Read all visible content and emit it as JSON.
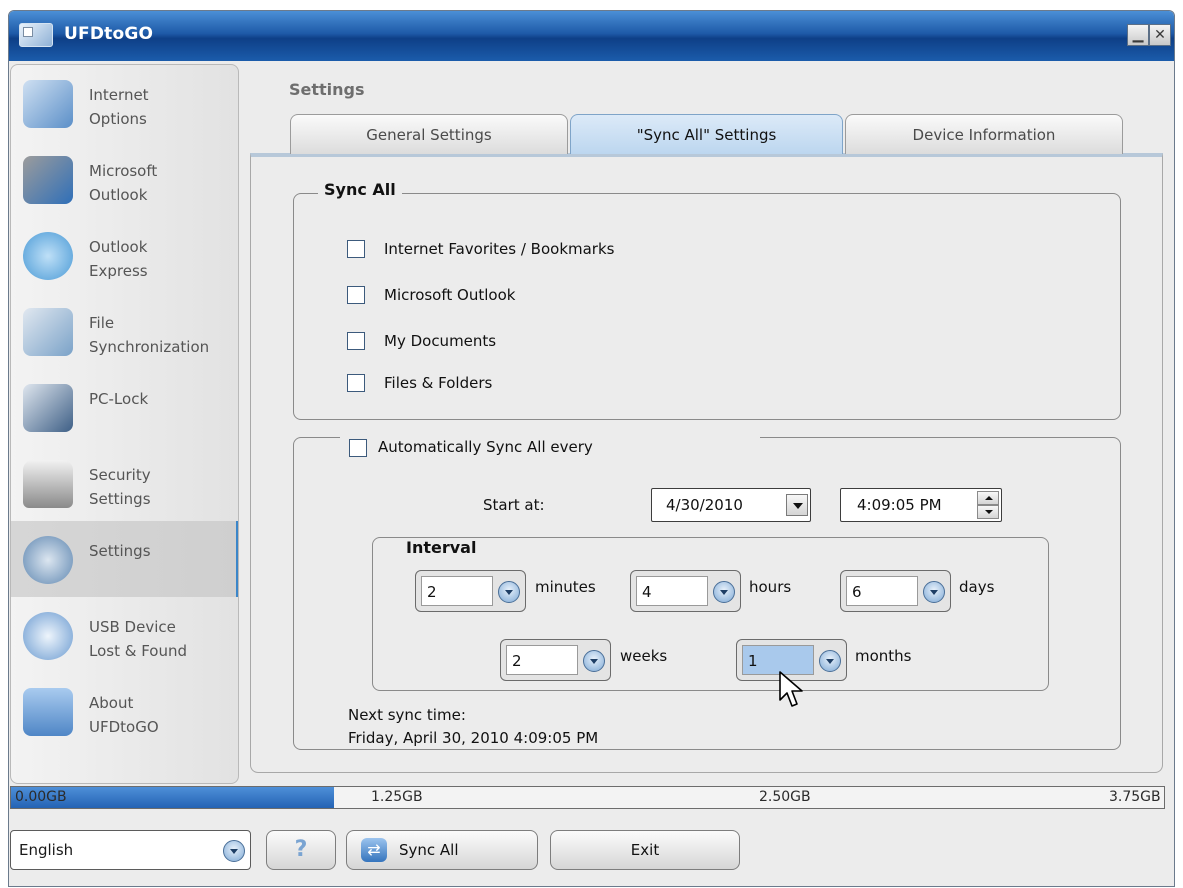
{
  "window": {
    "title": "UFDtoGO",
    "minimize_glyph": "▁",
    "close_glyph": "✕"
  },
  "sidebar": {
    "items": [
      {
        "label": "Internet\nOptions",
        "icon": "internet-options-icon",
        "color": "#5b8fc8"
      },
      {
        "label": "Microsoft\nOutlook",
        "icon": "outlook-icon",
        "color": "#2f6fb8"
      },
      {
        "label": "Outlook\nExpress",
        "icon": "outlook-express-icon",
        "color": "#4a9ad6"
      },
      {
        "label": "File\nSynchronization",
        "icon": "file-sync-icon",
        "color": "#7aa2c8"
      },
      {
        "label": "PC-Lock",
        "icon": "pc-lock-icon",
        "color": "#3e5f86"
      },
      {
        "label": "Security\nSettings",
        "icon": "padlock-icon",
        "color": "#8a8a8a"
      },
      {
        "label": "Settings",
        "icon": "gears-icon",
        "color": "#5f87b1"
      },
      {
        "label": "USB Device\nLost & Found",
        "icon": "usb-search-icon",
        "color": "#6a9ad0"
      },
      {
        "label": "About\nUFDtoGO",
        "icon": "about-briefcase-icon",
        "color": "#4f86c6"
      }
    ],
    "active_index": 6
  },
  "main": {
    "heading": "Settings",
    "tabs": [
      {
        "label": "General Settings"
      },
      {
        "label": "\"Sync All\" Settings"
      },
      {
        "label": "Device Information"
      }
    ],
    "active_tab": 1
  },
  "sync_all": {
    "legend": "Sync All",
    "options": [
      {
        "label": "Internet Favorites / Bookmarks",
        "checked": false
      },
      {
        "label": "Microsoft Outlook",
        "checked": false
      },
      {
        "label": "My Documents",
        "checked": false
      },
      {
        "label": "Files & Folders",
        "checked": false
      }
    ]
  },
  "auto_sync": {
    "checkbox_label": "Automatically Sync All every",
    "checked": false,
    "start_label": "Start at:",
    "start_date": "4/30/2010",
    "start_time": "4:09:05 PM",
    "interval_legend": "Interval",
    "minutes_value": "2",
    "minutes_label": "minutes",
    "hours_value": "4",
    "hours_label": "hours",
    "days_value": "6",
    "days_label": "days",
    "weeks_value": "2",
    "weeks_label": "weeks",
    "months_value": "1",
    "months_label": "months",
    "next_sync_label": "Next sync time:",
    "next_sync_value": "Friday, April 30, 2010 4:09:05 PM"
  },
  "usage": {
    "ticks": [
      "0.00GB",
      "1.25GB",
      "2.50GB",
      "3.75GB"
    ],
    "used_fraction": 0.28,
    "fill_color": "#2463b4"
  },
  "bottom": {
    "language": "English",
    "help_glyph": "?",
    "sync_label": "Sync All",
    "sync_glyph": "⇄",
    "exit_label": "Exit"
  }
}
